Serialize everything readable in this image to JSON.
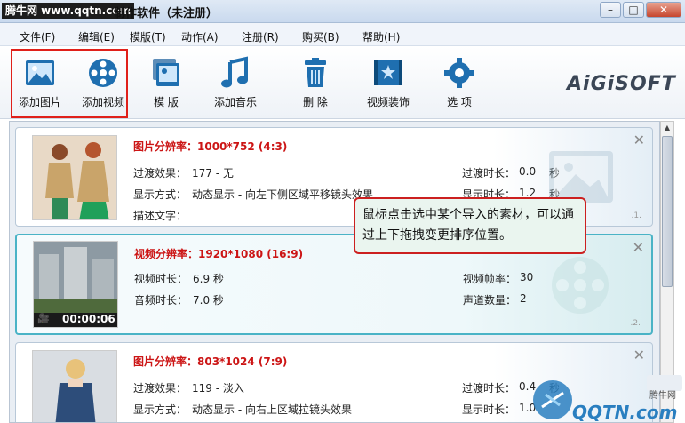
{
  "titlebar": {
    "site_label": "腾牛网 www.qqtn.com",
    "app_title": "制作软件（未注册）",
    "min": "–",
    "max": "□",
    "close": "✕"
  },
  "menu": {
    "items": [
      "文件(F)",
      "编辑(E)",
      "模版(T)",
      "动作(A)",
      "注册(R)",
      "购买(B)",
      "帮助(H)"
    ]
  },
  "toolbar": {
    "tools": [
      {
        "label": "添加图片",
        "icon": "add-image-icon"
      },
      {
        "label": "添加视频",
        "icon": "add-video-icon"
      },
      {
        "label": "模 版",
        "icon": "template-icon"
      },
      {
        "label": "添加音乐",
        "icon": "music-icon"
      },
      {
        "label": "删 除",
        "icon": "trash-icon"
      },
      {
        "label": "视频装饰",
        "icon": "decoration-icon"
      },
      {
        "label": "选 项",
        "icon": "gear-icon"
      }
    ],
    "brand": "AiGiSOFT"
  },
  "colors": {
    "accent_red": "#cc1515",
    "highlight_border": "#e0201a",
    "selected_border": "#4ab3c6"
  },
  "items": [
    {
      "resolution": "图片分辨率：1000*752 (4:3)",
      "transition_label": "过渡效果：",
      "transition_value": "177 - 无",
      "display_label": "显示方式：",
      "display_value": "动态显示 - 向左下侧区域平移镜头效果",
      "desc_label": "描述文字：",
      "transition_time_label": "过渡时长：",
      "transition_time_value": "0.0",
      "transition_time_unit": "秒",
      "display_time_label": "显示时长：",
      "display_time_value": "1.2",
      "display_time_unit": "秒",
      "index": ".1."
    },
    {
      "resolution": "视频分辨率：1920*1080 (16:9)",
      "duration_label": "视频时长：",
      "duration_value": "6.9 秒",
      "audio_label": "音频时长：",
      "audio_value": "7.0 秒",
      "fps_label": "视频帧率：",
      "fps_value": "30",
      "channels_label": "声道数量：",
      "channels_value": "2",
      "timecode": "00:00:06",
      "index": ".2."
    },
    {
      "resolution": "图片分辨率：803*1024 (7:9)",
      "transition_label": "过渡效果：",
      "transition_value": "119 - 淡入",
      "display_label": "显示方式：",
      "display_value": "动态显示 - 向右上区域拉镜头效果",
      "transition_time_label": "过渡时长：",
      "transition_time_value": "0.4",
      "transition_time_unit": "秒",
      "display_time_label": "显示时长：",
      "display_time_value": "1.0"
    }
  ],
  "callout": {
    "text": "鼠标点击选中某个导入的素材，可以通过上下拖拽变更排序位置。"
  },
  "corner_logo": {
    "badge": "腾牛网",
    "text": "QQTN.com"
  }
}
